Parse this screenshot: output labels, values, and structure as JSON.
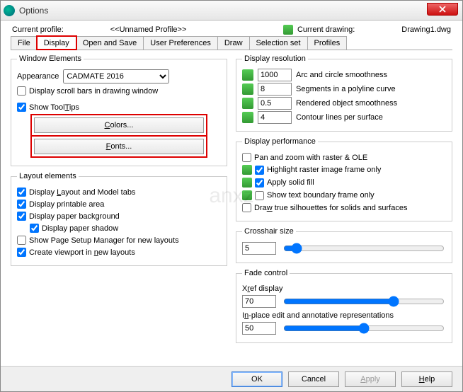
{
  "window": {
    "title": "Options"
  },
  "profile": {
    "label": "Current profile:",
    "value": "<<Unnamed Profile>>",
    "drawing_label": "Current drawing:",
    "drawing_value": "Drawing1.dwg"
  },
  "tabs": [
    "File",
    "Display",
    "Open and Save",
    "User Preferences",
    "Draw",
    "Selection set",
    "Profiles"
  ],
  "window_elements": {
    "legend": "Window Elements",
    "appearance_label": "Appearance",
    "appearance_value": "CADMATE 2016",
    "scrollbars": "Display scroll bars in drawing window",
    "tooltips": "Show ToolTips",
    "colors_btn": "Colors...",
    "fonts_btn": "Fonts..."
  },
  "layout_elements": {
    "legend": "Layout elements",
    "tabs": "Display Layout and Model tabs",
    "printable": "Display printable area",
    "paper_bg": "Display paper background",
    "paper_shadow": "Display paper shadow",
    "page_setup": "Show Page Setup Manager for new layouts",
    "viewport": "Create viewport in new layouts"
  },
  "display_resolution": {
    "legend": "Display resolution",
    "arc": {
      "value": "1000",
      "label": "Arc and circle smoothness"
    },
    "segments": {
      "value": "8",
      "label": "Segments in a polyline curve"
    },
    "rendered": {
      "value": "0.5",
      "label": "Rendered object smoothness"
    },
    "contour": {
      "value": "4",
      "label": "Contour lines per surface"
    }
  },
  "display_performance": {
    "legend": "Display performance",
    "pan": "Pan and zoom with raster & OLE",
    "highlight": "Highlight raster image frame only",
    "solid": "Apply solid fill",
    "textframe": "Show text boundary frame only",
    "silhouettes": "Draw true silhouettes for solids and surfaces"
  },
  "crosshair": {
    "legend": "Crosshair size",
    "value": "5"
  },
  "fade": {
    "legend": "Fade control",
    "xref_label": "Xref display",
    "xref_value": "70",
    "inplace_label": "In-place edit and annotative representations",
    "inplace_value": "50"
  },
  "footer": {
    "ok": "OK",
    "cancel": "Cancel",
    "apply": "Apply",
    "help": "Help"
  }
}
